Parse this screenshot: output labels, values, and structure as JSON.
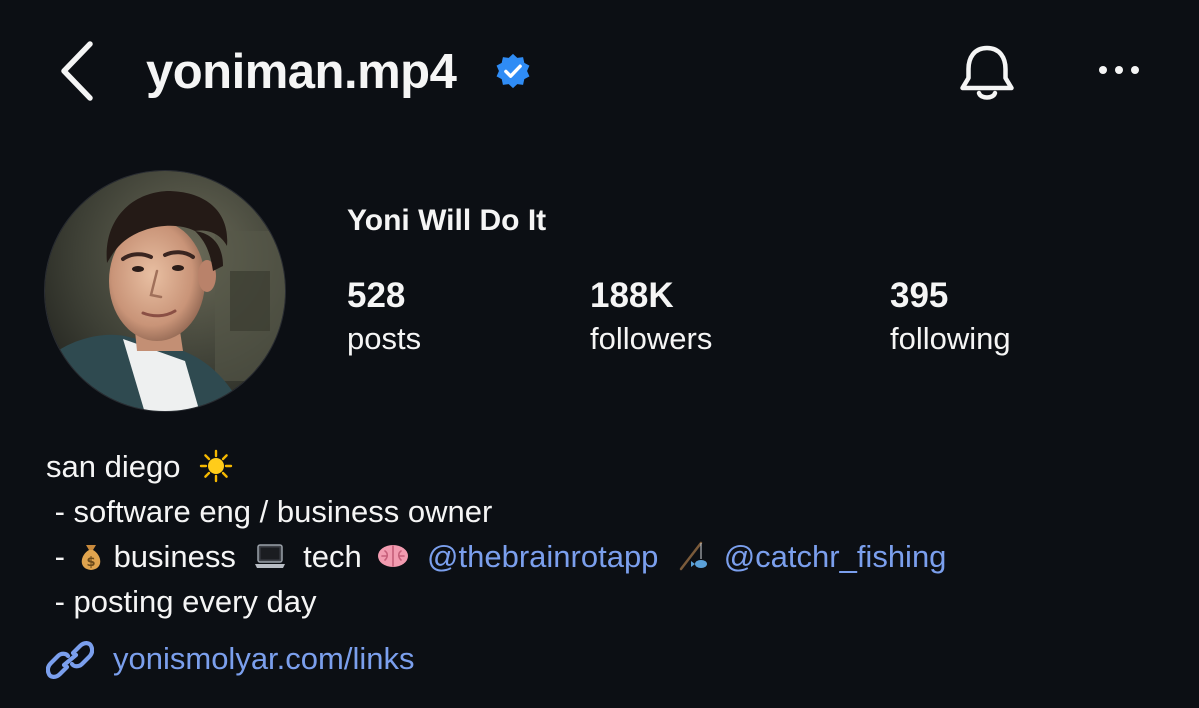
{
  "header": {
    "username": "yoniman.mp4",
    "verified": true,
    "icons": {
      "back": "chevron-left-icon",
      "verified": "verified-badge-icon",
      "notifications": "bell-icon",
      "more": "more-horizontal-icon"
    }
  },
  "profile": {
    "display_name": "Yoni Will Do It",
    "stats": [
      {
        "value": "528",
        "label": "posts"
      },
      {
        "value": "188K",
        "label": "followers"
      },
      {
        "value": "395",
        "label": "following"
      }
    ]
  },
  "bio": {
    "line1": "san diego",
    "line2": " - software eng / business owner",
    "line3_prefix": " - ",
    "line3_business": "business",
    "line3_tech": "tech",
    "mention1": "@thebrainrotapp",
    "mention2": "@catchr_fishing",
    "line4": " - posting every day",
    "emojis": [
      "sun",
      "money-bag",
      "laptop",
      "brain",
      "fishing-pole"
    ]
  },
  "link": {
    "text": "yonismolyar.com/links",
    "icon": "link-icon"
  },
  "colors": {
    "background": "#0c0f14",
    "text": "#f5f5f5",
    "link": "#7b9fed",
    "verified": "#2f8cf5"
  }
}
